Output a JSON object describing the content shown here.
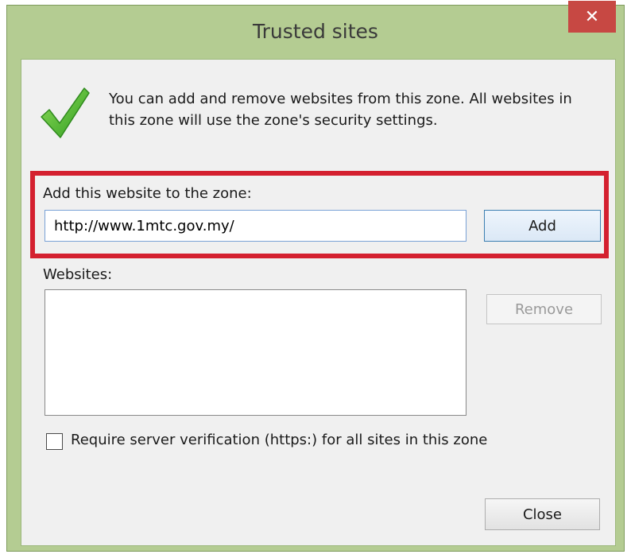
{
  "window": {
    "title": "Trusted sites",
    "close_glyph": "✕",
    "colors": {
      "frame": "#b4cc92",
      "close_button": "#c74843",
      "highlight_border": "#d4202f"
    }
  },
  "info": {
    "icon": "checkmark-icon",
    "text": "You can add and remove websites from this zone. All websites in this zone will use the zone's security settings."
  },
  "add_section": {
    "label": "Add this website to the zone:",
    "url_value": "http://www.1mtc.gov.my/",
    "add_label": "Add"
  },
  "websites_section": {
    "label": "Websites:",
    "items": [],
    "remove_label": "Remove"
  },
  "options": {
    "require_https_label": "Require server verification (https:) for all sites in this zone",
    "require_https_checked": false
  },
  "footer": {
    "close_label": "Close"
  }
}
